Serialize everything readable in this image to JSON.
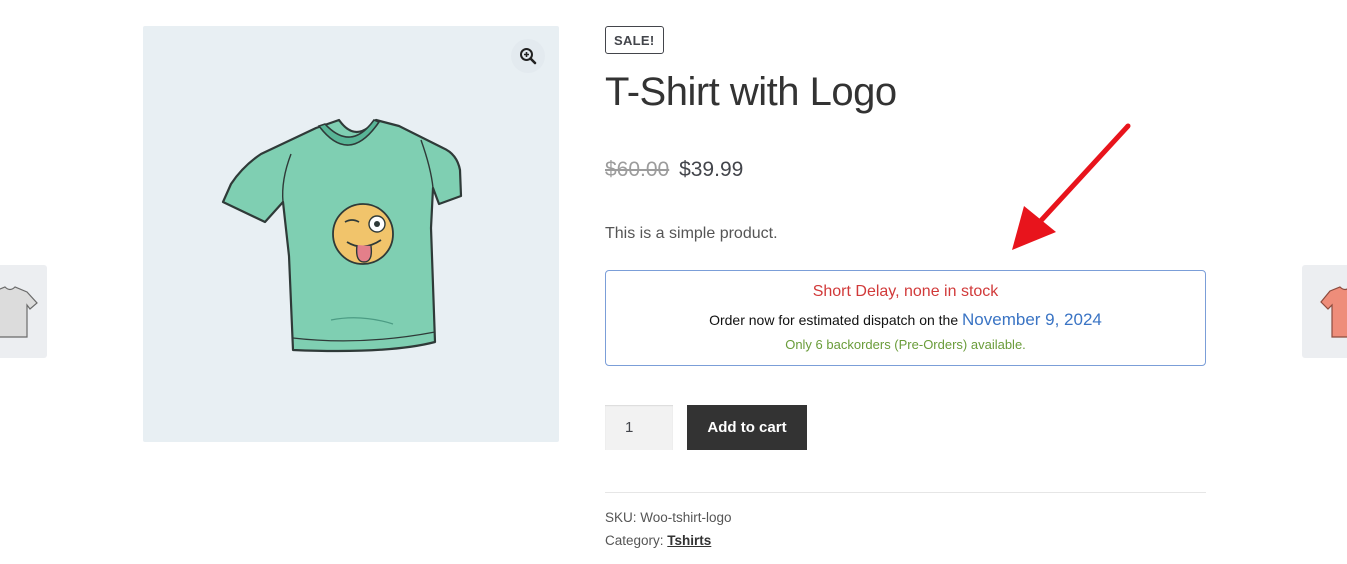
{
  "gallery": {
    "zoom_icon": "magnifier-plus-icon",
    "background": "#e8eff3"
  },
  "product": {
    "sale_badge": "SALE!",
    "title": "T-Shirt with Logo",
    "price_old": "$60.00",
    "price_new": "$39.99",
    "short_description": "This is a simple product."
  },
  "stock": {
    "status": "Short Delay, none in stock",
    "dispatch_prefix": "Order now for estimated dispatch on the",
    "dispatch_date": "November 9, 2024",
    "backorder_note": "Only 6 backorders (Pre-Orders) available.",
    "colors": {
      "status": "#d13a3a",
      "date": "#3a74c4",
      "note": "#6a9c3a",
      "border": "#7b9ed8"
    }
  },
  "cart": {
    "quantity": "1",
    "add_label": "Add to cart",
    "button_color": "#333333"
  },
  "meta": {
    "sku_label": "SKU:",
    "sku_value": "Woo-tshirt-logo",
    "category_label": "Category:",
    "category_value": "Tshirts"
  },
  "annotation": {
    "arrow_color": "#e8141c"
  }
}
